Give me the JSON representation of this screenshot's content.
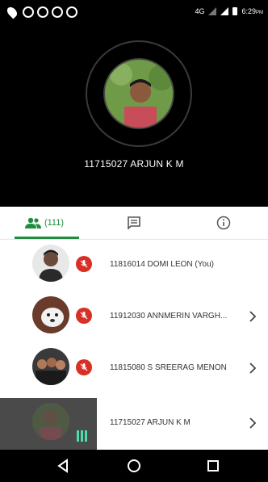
{
  "status_bar": {
    "network": "4G",
    "time": "6:29",
    "time_suffix": "PM",
    "left_icons": [
      "location-pin-icon",
      "whatsapp-icon",
      "whatsapp-icon",
      "whatsapp-icon",
      "whatsapp-icon"
    ]
  },
  "call": {
    "caller_name": "11715027 ARJUN K M"
  },
  "tabs": {
    "participants_count": "(111)",
    "items": [
      "people-icon",
      "chat-icon",
      "info-icon"
    ]
  },
  "participants": [
    {
      "name": "11816014 DOMI LEON (You)",
      "muted": true,
      "has_chevron": false
    },
    {
      "name": "11912030 ANNMERIN VARGH...",
      "muted": true,
      "has_chevron": true
    },
    {
      "name": "11815080 S SREERAG MENON",
      "muted": true,
      "has_chevron": true
    },
    {
      "name": "11715027 ARJUN K M",
      "muted": false,
      "speaking": true,
      "has_chevron": true
    }
  ],
  "colors": {
    "accent_green": "#1e8e3e",
    "mute_red": "#d93025",
    "speaking_bars": "#4ddbb0"
  }
}
